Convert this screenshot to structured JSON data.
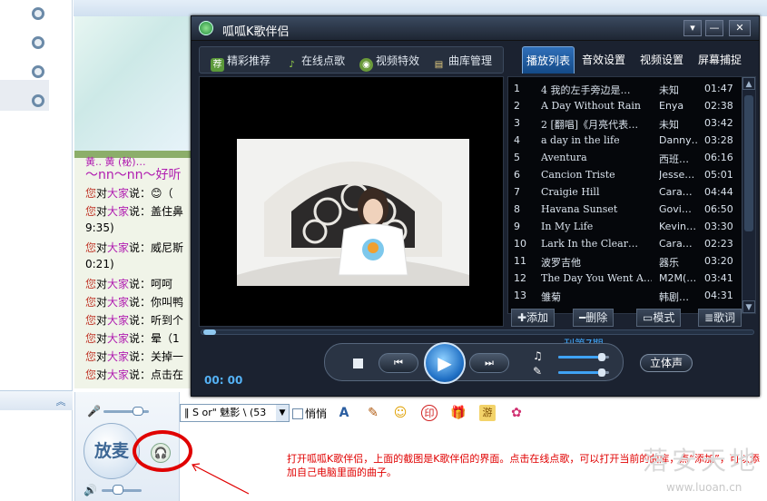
{
  "player": {
    "title": "呱呱K歌伴侣",
    "window_controls": [
      "▾",
      "—",
      "✕"
    ],
    "nav": [
      {
        "label": "精彩推荐",
        "icon": "recommend-icon"
      },
      {
        "label": "在线点歌",
        "icon": "music-note-icon"
      },
      {
        "label": "视频特效",
        "icon": "video-effect-icon"
      },
      {
        "label": "曲库管理",
        "icon": "library-icon"
      }
    ],
    "tabs": [
      "播放列表",
      "音效设置",
      "视频设置",
      "屏幕捕捉"
    ],
    "active_tab": "播放列表",
    "playlist": [
      {
        "num": "1",
        "title": "4  我的左手旁边是…",
        "artist": "未知",
        "duration": "01:47"
      },
      {
        "num": "2",
        "title": "A Day Without Rain",
        "artist": "Enya",
        "duration": "02:38"
      },
      {
        "num": "3",
        "title": "2 [翻唱]《月亮代表…",
        "artist": "未知",
        "duration": "03:42"
      },
      {
        "num": "4",
        "title": "a day in the life",
        "artist": "Danny…",
        "duration": "03:28"
      },
      {
        "num": "5",
        "title": "Aventura",
        "artist": "西班…",
        "duration": "06:16"
      },
      {
        "num": "6",
        "title": "Cancion Triste",
        "artist": "Jesse…",
        "duration": "05:01"
      },
      {
        "num": "7",
        "title": "Craigie Hill",
        "artist": "Cara…",
        "duration": "04:44"
      },
      {
        "num": "8",
        "title": "Havana Sunset",
        "artist": "Govi…",
        "duration": "06:50"
      },
      {
        "num": "9",
        "title": "In My Life",
        "artist": "Kevin…",
        "duration": "03:30"
      },
      {
        "num": "10",
        "title": "Lark In the Clear…",
        "artist": "Cara…",
        "duration": "02:23"
      },
      {
        "num": "11",
        "title": "波罗吉他",
        "artist": "器乐",
        "duration": "03:20"
      },
      {
        "num": "12",
        "title": "The Day You Went A…",
        "artist": "M2M(…",
        "duration": "03:41"
      },
      {
        "num": "13",
        "title": "雏菊",
        "artist": "韩剧…",
        "duration": "04:31"
      }
    ],
    "actions": [
      "✚添加",
      "━删除",
      "▭模式",
      "≣歌词"
    ],
    "now_playing": "刊第7期",
    "time": "00: 00",
    "stereo_label": "立体声",
    "music_volume": 0.85,
    "mic_volume": 0.85,
    "seek_progress": 0.0
  },
  "chat": {
    "header": "～nn～nn～好听",
    "header_top": "黄.. 黄 (秘)…",
    "lines": [
      {
        "user": "您",
        "mid": "对",
        "target": "大家",
        "text": "说：😊（"
      },
      {
        "user": "您",
        "mid": "对",
        "target": "大家",
        "text": "说：盖住鼻"
      },
      {
        "user": "",
        "mid": "",
        "target": "",
        "text": "9:35)"
      },
      {
        "user": "您",
        "mid": "对",
        "target": "大家",
        "text": "说：威尼斯"
      },
      {
        "user": "",
        "mid": "",
        "target": "",
        "text": "0:21)"
      },
      {
        "user": "您",
        "mid": "对",
        "target": "大家",
        "text": "说：呵呵"
      },
      {
        "user": "您",
        "mid": "对",
        "target": "大家",
        "text": "说：你叫鸭"
      },
      {
        "user": "您",
        "mid": "对",
        "target": "大家",
        "text": "说：听到个"
      },
      {
        "user": "您",
        "mid": "对",
        "target": "大家",
        "text": "说：晕（1"
      },
      {
        "user": "您",
        "mid": "对",
        "target": "大家",
        "text": "说：关掉一"
      },
      {
        "user": "您",
        "mid": "对",
        "target": "大家",
        "text": "说：点击在"
      }
    ]
  },
  "bottom": {
    "fangmai": "放麦",
    "font_select": "‖ S or\" 魅影 \\ (53",
    "qiaoqiao": "悄悄",
    "tool_icons": [
      "font-icon",
      "brush-icon",
      "emoji-icon",
      "stamp-icon",
      "gift-icon",
      "game-icon",
      "candy-icon"
    ],
    "tool_glyphs": [
      "A",
      "✎",
      "☺",
      "印",
      "🎁",
      "游",
      "✿"
    ]
  },
  "annotation": "打开呱呱K歌伴侣，上面的截图是K歌伴侣的界面。点击在线点歌，可以打开当前的曲库，点“添加”，可以添加自己电脑里面的曲子。",
  "watermark": {
    "text": "落安天地",
    "url": "www.luoan.cn"
  },
  "colors": {
    "accent": "#1f6fc4",
    "annotation": "#e00000",
    "player_bg": "#1b2230"
  }
}
